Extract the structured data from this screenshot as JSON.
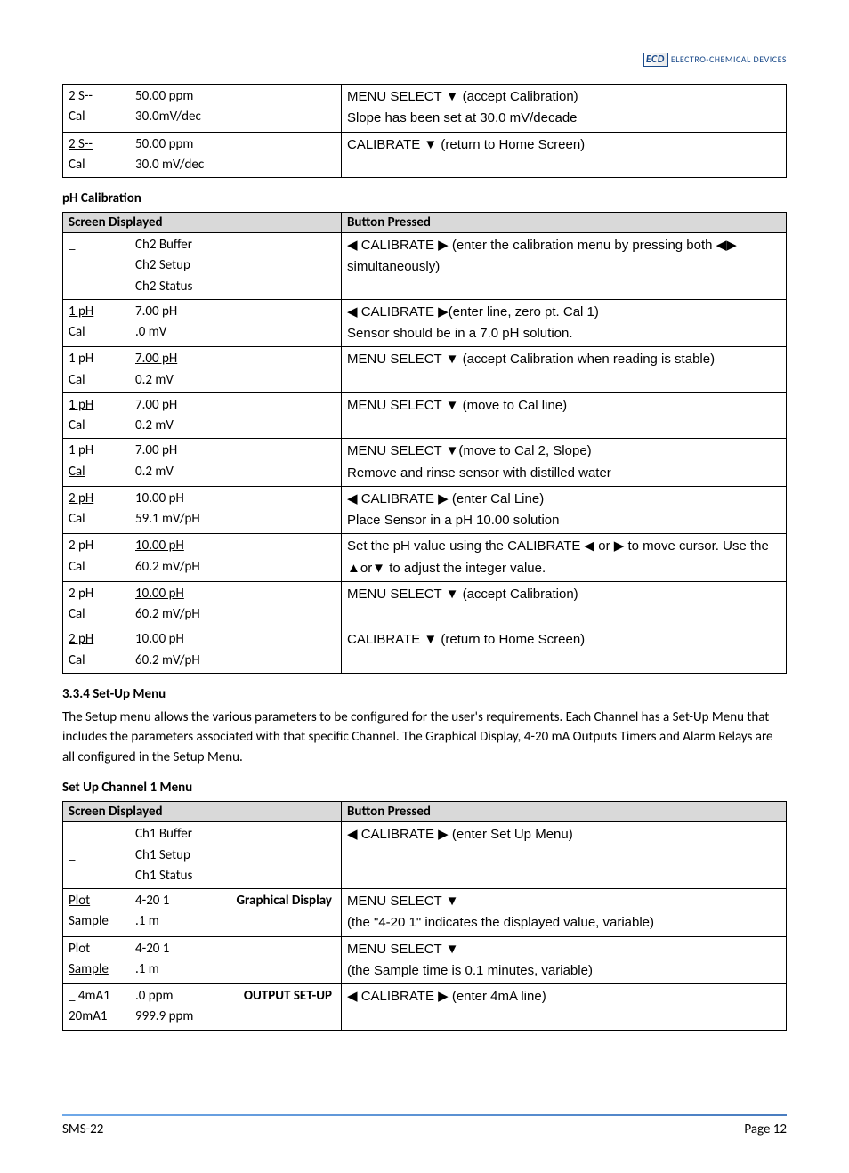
{
  "logo": {
    "brand": "ECD",
    "text": "ELECTRO-CHEMICAL DEVICES"
  },
  "table0": {
    "rows": [
      {
        "left": [
          {
            "c1": "2 S--",
            "c1u": true,
            "c2": "50.00 ppm",
            "c2u": true
          },
          {
            "c1": "Cal",
            "c2": "30.0mV/dec"
          }
        ],
        "right": [
          "MENU SELECT ▼ (accept Calibration)",
          "Slope has been set at 30.0 mV/decade"
        ]
      },
      {
        "left": [
          {
            "c1": "2 S--",
            "c1u": true,
            "c2": "50.00 ppm"
          },
          {
            "c1": "Cal",
            "c2": "30.0 mV/dec"
          }
        ],
        "right": [
          "CALIBRATE ▼ (return to Home Screen)"
        ]
      }
    ]
  },
  "h1": "pH Calibration",
  "table1": {
    "hLeft": "Screen Displayed",
    "hRight": "Button Pressed",
    "rows": [
      {
        "left": [
          {
            "c1": "",
            "c2": "Ch2 Buffer",
            "pre": "_"
          },
          {
            "c1": "",
            "c2": "Ch2 Setup"
          },
          {
            "c1": "",
            "c2": "Ch2 Status"
          }
        ],
        "right": [
          "◀ CALIBRATE ▶ (enter the calibration menu by pressing both ◀▶ simultaneously)"
        ]
      },
      {
        "left": [
          {
            "c1": "1 pH",
            "c1u": true,
            "c2": "7.00 pH"
          },
          {
            "c1": "Cal",
            "c2": ".0 mV"
          }
        ],
        "right": [
          "◀ CALIBRATE ▶(enter line, zero pt. Cal 1)",
          "Sensor should be in a 7.0 pH solution."
        ]
      },
      {
        "left": [
          {
            "c1": "1 pH",
            "c2": "7.00 pH",
            "c2u": true
          },
          {
            "c1": "Cal",
            "c2": "0.2 mV"
          }
        ],
        "right": [
          "MENU SELECT ▼ (accept Calibration when reading is stable)"
        ]
      },
      {
        "left": [
          {
            "c1": "1 pH",
            "c1u": true,
            "c2": "7.00 pH"
          },
          {
            "c1": "Cal",
            "c2": "0.2 mV"
          }
        ],
        "right": [
          "MENU SELECT ▼ (move to Cal line)"
        ]
      },
      {
        "left": [
          {
            "c1": "1 pH",
            "c2": "7.00 pH"
          },
          {
            "c1": "Cal",
            "c1u": true,
            "c2": "0.2 mV"
          }
        ],
        "right": [
          "MENU SELECT ▼(move to Cal 2, Slope)",
          "Remove and rinse sensor with distilled water"
        ]
      },
      {
        "left": [
          {
            "c1": "2 pH",
            "c1u": true,
            "c2": "10.00 pH"
          },
          {
            "c1": "Cal",
            "c2": "59.1 mV/pH"
          }
        ],
        "right": [
          "◀ CALIBRATE ▶ (enter Cal Line)",
          "Place Sensor in a pH 10.00 solution"
        ]
      },
      {
        "left": [
          {
            "c1": "2 pH",
            "c2": "10.00 pH",
            "c2u": true
          },
          {
            "c1": "Cal",
            "c2": "60.2 mV/pH"
          }
        ],
        "right": [
          "Set the pH value using the CALIBRATE ◀ or ▶ to move cursor. Use the ▲or▼ to adjust the integer value."
        ]
      },
      {
        "left": [
          {
            "c1": "2 pH",
            "c2": "10.00 pH",
            "c2u": true
          },
          {
            "c1": "Cal",
            "c2": "60.2 mV/pH"
          }
        ],
        "right": [
          "MENU SELECT ▼ (accept Calibration)"
        ]
      },
      {
        "left": [
          {
            "c1": "2 pH",
            "c1u": true,
            "c2": "10.00 pH"
          },
          {
            "c1": "Cal",
            "c2": "60.2 mV/pH"
          }
        ],
        "right": [
          "CALIBRATE ▼ (return to Home Screen)"
        ]
      }
    ]
  },
  "h2": "3.3.4 Set-Up Menu",
  "p2": "The Setup menu allows the various parameters to be configured for the user's requirements. Each Channel has a Set-Up Menu that includes the parameters associated with that specific Channel. The Graphical Display, 4-20 mA Outputs Timers and Alarm Relays are all configured in the Setup Menu.",
  "h3": "Set Up Channel 1 Menu",
  "table2": {
    "hLeft": "Screen Displayed",
    "hRight": "Button Pressed",
    "rows": [
      {
        "left": [
          {
            "c1": "",
            "c2": "Ch1 Buffer"
          },
          {
            "c1": "",
            "c2": "Ch1 Setup",
            "pre": "_"
          },
          {
            "c1": "",
            "c2": "Ch1 Status"
          }
        ],
        "right": [
          "◀ CALIBRATE ▶ (enter Set Up Menu)"
        ]
      },
      {
        "left": [
          {
            "c1": "Plot",
            "c1u": true,
            "c2": "4-20   1",
            "c3": "Graphical Display"
          },
          {
            "c1": "Sample",
            "c2": "   .1 m"
          }
        ],
        "right": [
          "MENU SELECT ▼",
          "(the \"4-20  1\" indicates the displayed value, variable)"
        ]
      },
      {
        "left": [
          {
            "c1": "Plot",
            "c2": "4-20   1"
          },
          {
            "c1": "Sample",
            "c1u": true,
            "c2": "   .1 m"
          }
        ],
        "right": [
          "MENU SELECT ▼",
          "(the Sample time is 0.1 minutes, variable)"
        ]
      },
      {
        "left": [
          {
            "c1": " 4mA1",
            "c2": "   .0 ppm",
            "c3": "OUTPUT SET-UP",
            "pre": "_"
          },
          {
            "c1": "20mA1",
            "c2": "999.9 ppm"
          }
        ],
        "right": [
          "◀ CALIBRATE ▶ (enter 4mA line)"
        ]
      }
    ]
  },
  "footer": {
    "left": "SMS-22",
    "right": "Page 12"
  }
}
